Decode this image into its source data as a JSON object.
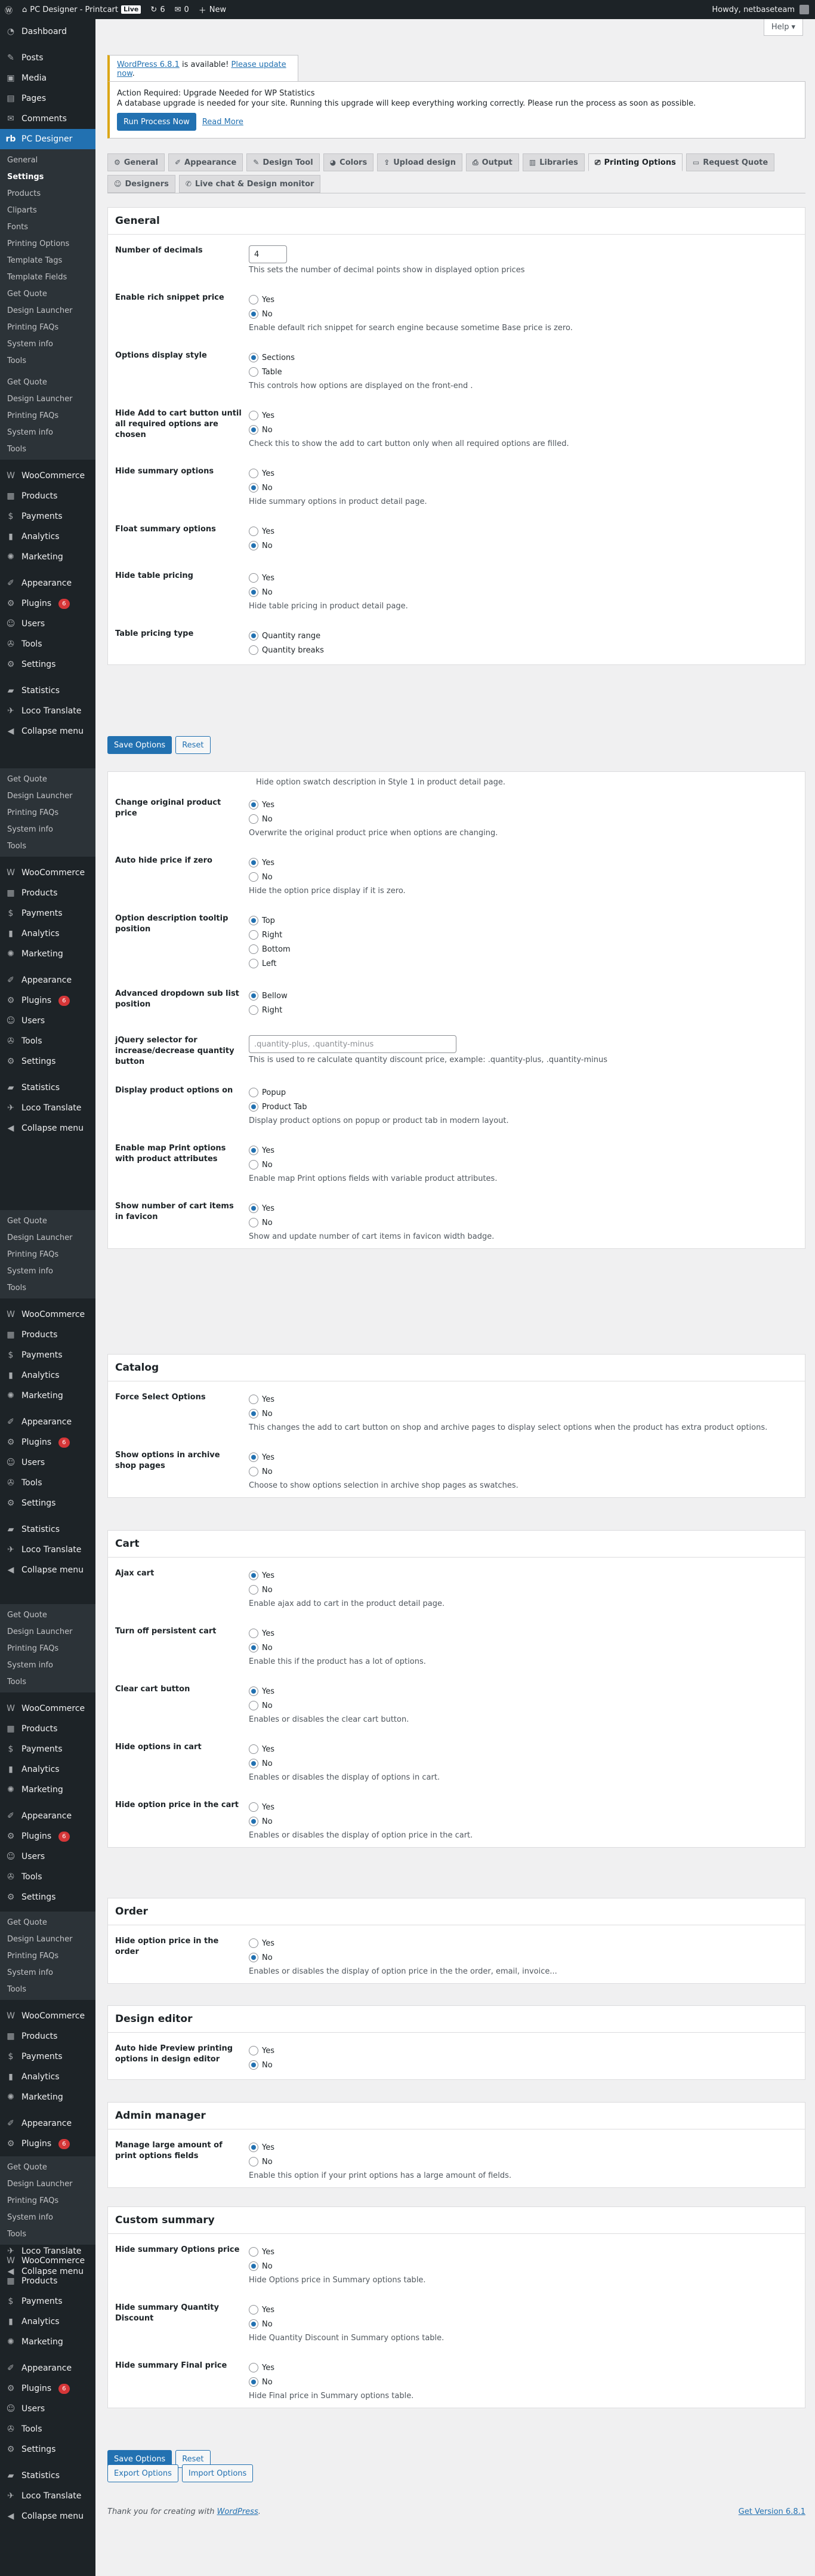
{
  "admin_bar": {
    "site_name": "PC Designer - Printcart",
    "live": "Live",
    "updates": "6",
    "comments": "0",
    "new": "New",
    "howdy": "Howdy, netbaseteam"
  },
  "help": "Help",
  "sidebar_main": [
    {
      "label": "Dashboard",
      "icon": "dashboard-icon",
      "glyph": "◔"
    },
    {
      "label": "Posts",
      "icon": "pin-icon",
      "glyph": "✎"
    },
    {
      "label": "Media",
      "icon": "media-icon",
      "glyph": "▣"
    },
    {
      "label": "Pages",
      "icon": "page-icon",
      "glyph": "▤"
    },
    {
      "label": "Comments",
      "icon": "comment-icon",
      "glyph": "✉"
    }
  ],
  "pc_designer": {
    "label": "PC Designer",
    "glyph": "rb"
  },
  "pc_sub": [
    "General",
    "Settings",
    "Products",
    "Cliparts",
    "Fonts",
    "Printing Options",
    "Template Tags",
    "Template Fields",
    "Get Quote",
    "Design Launcher",
    "Printing FAQs",
    "System info",
    "Tools"
  ],
  "extra_sub": [
    "Get Quote",
    "Design Launcher",
    "Printing FAQs",
    "System info",
    "Tools"
  ],
  "sidebar_rest": [
    {
      "label": "WooCommerce",
      "icon": "woocommerce-icon",
      "glyph": "W"
    },
    {
      "label": "Products",
      "icon": "products-icon",
      "glyph": "▦"
    },
    {
      "label": "Payments",
      "icon": "payments-icon",
      "glyph": "$"
    },
    {
      "label": "Analytics",
      "icon": "analytics-icon",
      "glyph": "▮"
    },
    {
      "label": "Marketing",
      "icon": "marketing-icon",
      "glyph": "✺"
    },
    {
      "label": "Appearance",
      "icon": "appearance-icon",
      "glyph": "✐"
    },
    {
      "label": "Plugins",
      "icon": "plugins-icon",
      "glyph": "⚙",
      "badge": "6"
    },
    {
      "label": "Users",
      "icon": "users-icon",
      "glyph": "☺"
    },
    {
      "label": "Tools",
      "icon": "tools-icon",
      "glyph": "✇"
    },
    {
      "label": "Settings",
      "icon": "settings-icon",
      "glyph": "⚙"
    },
    {
      "label": "Statistics",
      "icon": "statistics-icon",
      "glyph": "▰"
    },
    {
      "label": "Loco Translate",
      "icon": "translate-icon",
      "glyph": "✈"
    },
    {
      "label": "Collapse menu",
      "icon": "collapse-icon",
      "glyph": "◀"
    }
  ],
  "update_notice": {
    "prefix": "WordPress 6.8.1",
    "middle": " is available! ",
    "link": "Please update now",
    "suffix": "."
  },
  "db_notice": {
    "title": "Action Required: Upgrade Needed for WP Statistics",
    "text": "A database upgrade is needed for your site. Running this upgrade will keep everything working correctly. Please run the process as soon as possible.",
    "run": "Run Process Now",
    "read": "Read More"
  },
  "tabs": [
    {
      "label": "General",
      "glyph": "⚙",
      "icon": "gear-icon"
    },
    {
      "label": "Appearance",
      "glyph": "✐",
      "icon": "brush-icon"
    },
    {
      "label": "Design Tool",
      "glyph": "✎",
      "icon": "pencil-icon"
    },
    {
      "label": "Colors",
      "glyph": "◕",
      "icon": "palette-icon"
    },
    {
      "label": "Upload design",
      "glyph": "⇪",
      "icon": "upload-icon"
    },
    {
      "label": "Output",
      "glyph": "⎙",
      "icon": "output-icon"
    },
    {
      "label": "Libraries",
      "glyph": "▥",
      "icon": "library-icon"
    },
    {
      "label": "Printing Options",
      "glyph": "⎚",
      "icon": "printer-icon",
      "active": true
    },
    {
      "label": "Request Quote",
      "glyph": "▭",
      "icon": "quote-icon"
    },
    {
      "label": "Designers",
      "glyph": "☺",
      "icon": "designers-icon"
    },
    {
      "label": "Live chat & Design monitor",
      "glyph": "✆",
      "icon": "chat-icon"
    }
  ],
  "general": {
    "title": "General",
    "decimals": {
      "label": "Number of decimals",
      "value": "4",
      "desc": "This sets the number of decimal points show in displayed option prices"
    },
    "rows": [
      {
        "label": "Enable rich snippet price",
        "options": [
          "Yes",
          "No"
        ],
        "sel": 1,
        "desc": "Enable default rich snippet for search engine because sometime Base price is zero."
      },
      {
        "label": "Options display style",
        "options": [
          "Sections",
          "Table"
        ],
        "sel": 0,
        "desc": "This controls how options are displayed on the front-end ."
      },
      {
        "label": "Hide Add to cart button until all required options are chosen",
        "options": [
          "Yes",
          "No"
        ],
        "sel": 1,
        "desc": "Check this to show the add to cart button only when all required options are filled."
      },
      {
        "label": "Hide summary options",
        "options": [
          "Yes",
          "No"
        ],
        "sel": 1,
        "desc": "Hide summary options in product detail page."
      },
      {
        "label": "Float summary options",
        "options": [
          "Yes",
          "No"
        ],
        "sel": 1,
        "desc": ""
      },
      {
        "label": "Hide table pricing",
        "options": [
          "Yes",
          "No"
        ],
        "sel": 1,
        "desc": "Hide table pricing in product detail page."
      },
      {
        "label": "Table pricing type",
        "options": [
          "Quantity range",
          "Quantity breaks"
        ],
        "sel": 0,
        "desc": ""
      }
    ]
  },
  "actions": {
    "save": "Save Options",
    "reset": "Reset",
    "export": "Export Options",
    "import": "Import Options"
  },
  "general2": {
    "top_desc": "Hide option swatch description in Style 1 in product detail page.",
    "rows": [
      {
        "label": "Change original product price",
        "options": [
          "Yes",
          "No"
        ],
        "sel": 0,
        "desc": "Overwrite the original product price when options are changing."
      },
      {
        "label": "Auto hide price if zero",
        "options": [
          "Yes",
          "No"
        ],
        "sel": 0,
        "desc": "Hide the option price display if it is zero."
      },
      {
        "label": "Option description tooltip position",
        "options": [
          "Top",
          "Right",
          "Bottom",
          "Left"
        ],
        "sel": 0,
        "desc": ""
      },
      {
        "label": "Advanced dropdown sub list position",
        "options": [
          "Bellow",
          "Right"
        ],
        "sel": 0,
        "desc": ""
      }
    ],
    "jquery": {
      "label": "jQuery selector for increase/decrease quantity button",
      "value": ".quantity-plus, .quantity-minus",
      "desc": "This is used to re calculate quantity discount price, example: .quantity-plus, .quantity-minus"
    },
    "rows2": [
      {
        "label": "Display product options on",
        "options": [
          "Popup",
          "Product Tab"
        ],
        "sel": 1,
        "desc": "Display product options on popup or product tab in modern layout."
      },
      {
        "label": "Enable map Print options with product attributes",
        "options": [
          "Yes",
          "No"
        ],
        "sel": 0,
        "desc": "Enable map Print options fields with variable product attributes."
      },
      {
        "label": "Show number of cart items in favicon",
        "options": [
          "Yes",
          "No"
        ],
        "sel": 0,
        "desc": "Show and update number of cart items in favicon width badge."
      }
    ]
  },
  "catalog": {
    "title": "Catalog",
    "rows": [
      {
        "label": "Force Select Options",
        "options": [
          "Yes",
          "No"
        ],
        "sel": 1,
        "desc": "This changes the add to cart button on shop and archive pages to display select options when the product has extra product options."
      },
      {
        "label": "Show options in archive shop pages",
        "options": [
          "Yes",
          "No"
        ],
        "sel": 0,
        "desc": "Choose to show options selection in archive shop pages as swatches."
      }
    ]
  },
  "cart": {
    "title": "Cart",
    "rows": [
      {
        "label": "Ajax cart",
        "options": [
          "Yes",
          "No"
        ],
        "sel": 0,
        "desc": "Enable ajax add to cart in the product detail page."
      },
      {
        "label": "Turn off persistent cart",
        "options": [
          "Yes",
          "No"
        ],
        "sel": 1,
        "desc": "Enable this if the product has a lot of options."
      },
      {
        "label": "Clear cart button",
        "options": [
          "Yes",
          "No"
        ],
        "sel": 0,
        "desc": "Enables or disables the clear cart button."
      },
      {
        "label": "Hide options in cart",
        "options": [
          "Yes",
          "No"
        ],
        "sel": 1,
        "desc": "Enables or disables the display of options in cart."
      },
      {
        "label": "Hide option price in the cart",
        "options": [
          "Yes",
          "No"
        ],
        "sel": 1,
        "desc": "Enables or disables the display of option price in the cart."
      }
    ]
  },
  "order": {
    "title": "Order",
    "rows": [
      {
        "label": "Hide option price in the order",
        "options": [
          "Yes",
          "No"
        ],
        "sel": 1,
        "desc": "Enables or disables the display of option price in the the order, email, invoice..."
      }
    ]
  },
  "design_editor": {
    "title": "Design editor",
    "rows": [
      {
        "label": "Auto hide Preview printing options in design editor",
        "options": [
          "Yes",
          "No"
        ],
        "sel": 1,
        "desc": ""
      }
    ]
  },
  "admin_manager": {
    "title": "Admin manager",
    "rows": [
      {
        "label": "Manage large amount of print options fields",
        "options": [
          "Yes",
          "No"
        ],
        "sel": 0,
        "desc": "Enable this option if your print options has a large amount of fields."
      }
    ]
  },
  "custom_summary": {
    "title": "Custom summary",
    "rows": [
      {
        "label": "Hide summary Options price",
        "options": [
          "Yes",
          "No"
        ],
        "sel": 1,
        "desc": "Hide Options price in Summary options table."
      },
      {
        "label": "Hide summary Quantity Discount",
        "options": [
          "Yes",
          "No"
        ],
        "sel": 1,
        "desc": "Hide Quantity Discount in Summary options table."
      },
      {
        "label": "Hide summary Final price",
        "options": [
          "Yes",
          "No"
        ],
        "sel": 1,
        "desc": "Hide Final price in Summary options table."
      }
    ]
  },
  "footer": {
    "thanks": "Thank you for creating with ",
    "wp": "WordPress",
    "period": ".",
    "version": "Get Version 6.8.1"
  }
}
